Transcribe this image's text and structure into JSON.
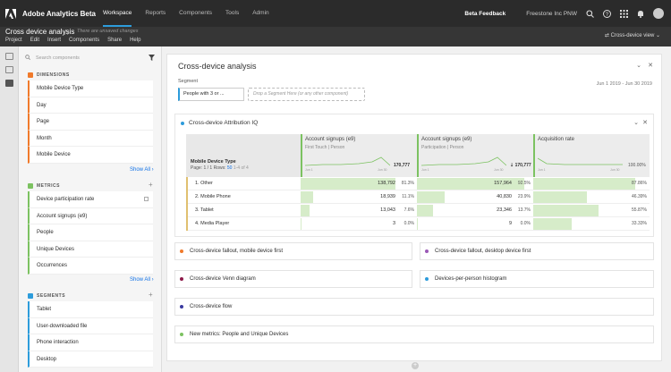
{
  "app": {
    "title": "Adobe Analytics Beta",
    "nav": [
      "Workspace",
      "Reports",
      "Components",
      "Tools",
      "Admin"
    ],
    "beta_feedback": "Beta Feedback",
    "org": "Freestone Inc PNW",
    "icons": [
      "search-icon",
      "help-icon",
      "apps-grid-icon",
      "bell-icon",
      "user-avatar"
    ]
  },
  "project": {
    "title": "Cross device analysis",
    "unsaved": "There are unsaved changes",
    "menu": [
      "Project",
      "Edit",
      "Insert",
      "Components",
      "Share",
      "Help"
    ],
    "view": "Cross-device view"
  },
  "sidebar": {
    "search_placeholder": "Search components",
    "dimensions": {
      "title": "DIMENSIONS",
      "color": "#f07a2b",
      "items": [
        "Mobile Device Type",
        "Day",
        "Page",
        "Month",
        "Mobile Device"
      ]
    },
    "metrics": {
      "title": "METRICS",
      "color": "#7cc261",
      "items": [
        "Device participation rate",
        "Account signups (e9)",
        "People",
        "Unique Devices",
        "Occurrences"
      ]
    },
    "segments": {
      "title": "SEGMENTS",
      "color": "#2d9cdb",
      "items": [
        "Tablet",
        "User-downloaded file",
        "Phone interaction",
        "Desktop"
      ]
    },
    "show_all": "Show All"
  },
  "panel": {
    "title": "Cross-device analysis",
    "segment_label": "Segment",
    "segment_value": "People with 3 or ...",
    "drop_zone": "Drop a Segment Here (or any other component)",
    "date_range": "Jun 1 2019 - Jun 30 2019"
  },
  "freeform": {
    "title": "Cross-device Attribution IQ",
    "dimension": "Mobile Device Type",
    "page_info": {
      "page": "Page: 1 / 1",
      "rows_label": "Rows:",
      "rows": "50",
      "range": "1-4 of 4"
    },
    "columns": [
      {
        "name": "Account signups (e9)",
        "sub": "First Touch | Person",
        "total": "170,777",
        "spk_start": "Jun 1",
        "spk_end": "Jun 30"
      },
      {
        "name": "Account signups (e9)",
        "sub": "Participation | Person",
        "total": "170,777",
        "spk_start": "Jun 1",
        "spk_end": "Jun 30"
      },
      {
        "name": "Acquisition rate",
        "sub": "",
        "total": "100.00%",
        "spk_start": "Jun 1",
        "spk_end": "Jun 30"
      }
    ],
    "rows": [
      {
        "label": "1. Other",
        "c1": "138,792",
        "p1": "81.3%",
        "f1": 0.813,
        "c2": "157,964",
        "p2": "92.5%",
        "f2": 0.925,
        "c3": "87.86%",
        "f3": 0.8786
      },
      {
        "label": "2. Mobile Phone",
        "c1": "18,939",
        "p1": "11.1%",
        "f1": 0.111,
        "c2": "40,830",
        "p2": "23.9%",
        "f2": 0.239,
        "c3": "46.39%",
        "f3": 0.4639
      },
      {
        "label": "3. Tablet",
        "c1": "13,043",
        "p1": "7.6%",
        "f1": 0.076,
        "c2": "23,346",
        "p2": "13.7%",
        "f2": 0.137,
        "c3": "55.87%",
        "f3": 0.5587
      },
      {
        "label": "4. Media Player",
        "c1": "3",
        "p1": "0.0%",
        "f1": 0,
        "c2": "9",
        "p2": "0.0%",
        "f2": 0,
        "c3": "33.33%",
        "f3": 0.3333
      }
    ]
  },
  "cards": [
    {
      "title": "Cross-device fallout, mobile device first",
      "color": "#f07a2b"
    },
    {
      "title": "Cross-device fallout, desktop device first",
      "color": "#9b59b6"
    },
    {
      "title": "Cross-device Venn diagram",
      "color": "#8e1a4a"
    },
    {
      "title": "Devices-per-person histogram",
      "color": "#2d9cdb"
    },
    {
      "title": "Cross-device flow",
      "color": "#3a3aa0"
    },
    {
      "title": "New metrics: People and Unique Devices",
      "color": "#7cc261"
    }
  ]
}
